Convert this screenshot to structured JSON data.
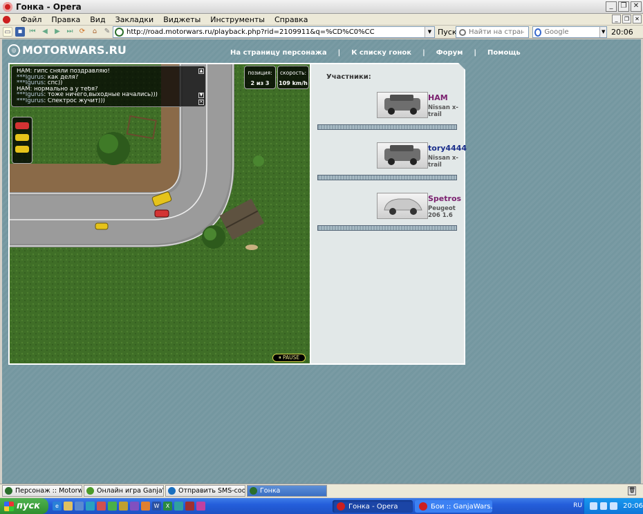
{
  "window": {
    "title": "Гонка - Opera"
  },
  "menu": [
    "Файл",
    "Правка",
    "Вид",
    "Закладки",
    "Виджеты",
    "Инструменты",
    "Справка"
  ],
  "toolbar": {
    "address": "http://road.motorwars.ru/playback.php?rid=2109911&q=%CD%C0%CC",
    "go_label": "Пуск",
    "find_placeholder": "Найти на странице",
    "search_placeholder": "Google",
    "clock": "20:06"
  },
  "site": {
    "logo": "MOTORWARS.RU",
    "nav": [
      "На страницу персонажа",
      "К списку гонок",
      "Форум",
      "Помощь"
    ]
  },
  "game": {
    "chat": [
      {
        "nick": "",
        "text": "НАМ: гипс сняли поздравляю!"
      },
      {
        "nick": "***Igurus",
        "text": ": как деля?"
      },
      {
        "nick": "***Igurus",
        "text": ": спс))"
      },
      {
        "nick": "",
        "text": "НАМ: нормально а у тебя?"
      },
      {
        "nick": "***Igurus",
        "text": ": тоже ничего,выходные начались)))"
      },
      {
        "nick": "***Igurus",
        "text": ": Спектрос жучит)))"
      }
    ],
    "position_label": "позиция:",
    "position_value": "2 из 3",
    "speed_label": "скорость:",
    "speed_value": "109 km/h",
    "pause_label": "⏸ PAUSE",
    "car_colors": [
      "#d33333",
      "#e6c31a",
      "#e6c31a"
    ]
  },
  "participants": {
    "heading": "Участники:",
    "list": [
      {
        "name": "НАМ",
        "model": "Nissan x-trail",
        "color": "#7a1f6e"
      },
      {
        "name": "tory4444",
        "model": "Nissan x-trail",
        "color": "#1a2e8a"
      },
      {
        "name": "Spetros",
        "model": "Peugeot 206 1.6",
        "color": "#7a1f6e"
      }
    ]
  },
  "tabs": [
    {
      "label": "Персонаж :: Motorwars.ru",
      "icon_color": "#2b6e2b"
    },
    {
      "label": "Онлайн игра GanjaWars...",
      "icon_color": "#4c9a2a"
    },
    {
      "label": "Отправить SMS-сообщ...",
      "icon_color": "#1a6fbf"
    },
    {
      "label": "Гонка",
      "icon_color": "#2b6e2b",
      "active": true
    }
  ],
  "taskbar": {
    "start": "пуск",
    "tasks": [
      "Гонка - Opera",
      "Бои :: GanjaWars.Ru..."
    ],
    "lang": "RU",
    "clock": "20:06"
  }
}
